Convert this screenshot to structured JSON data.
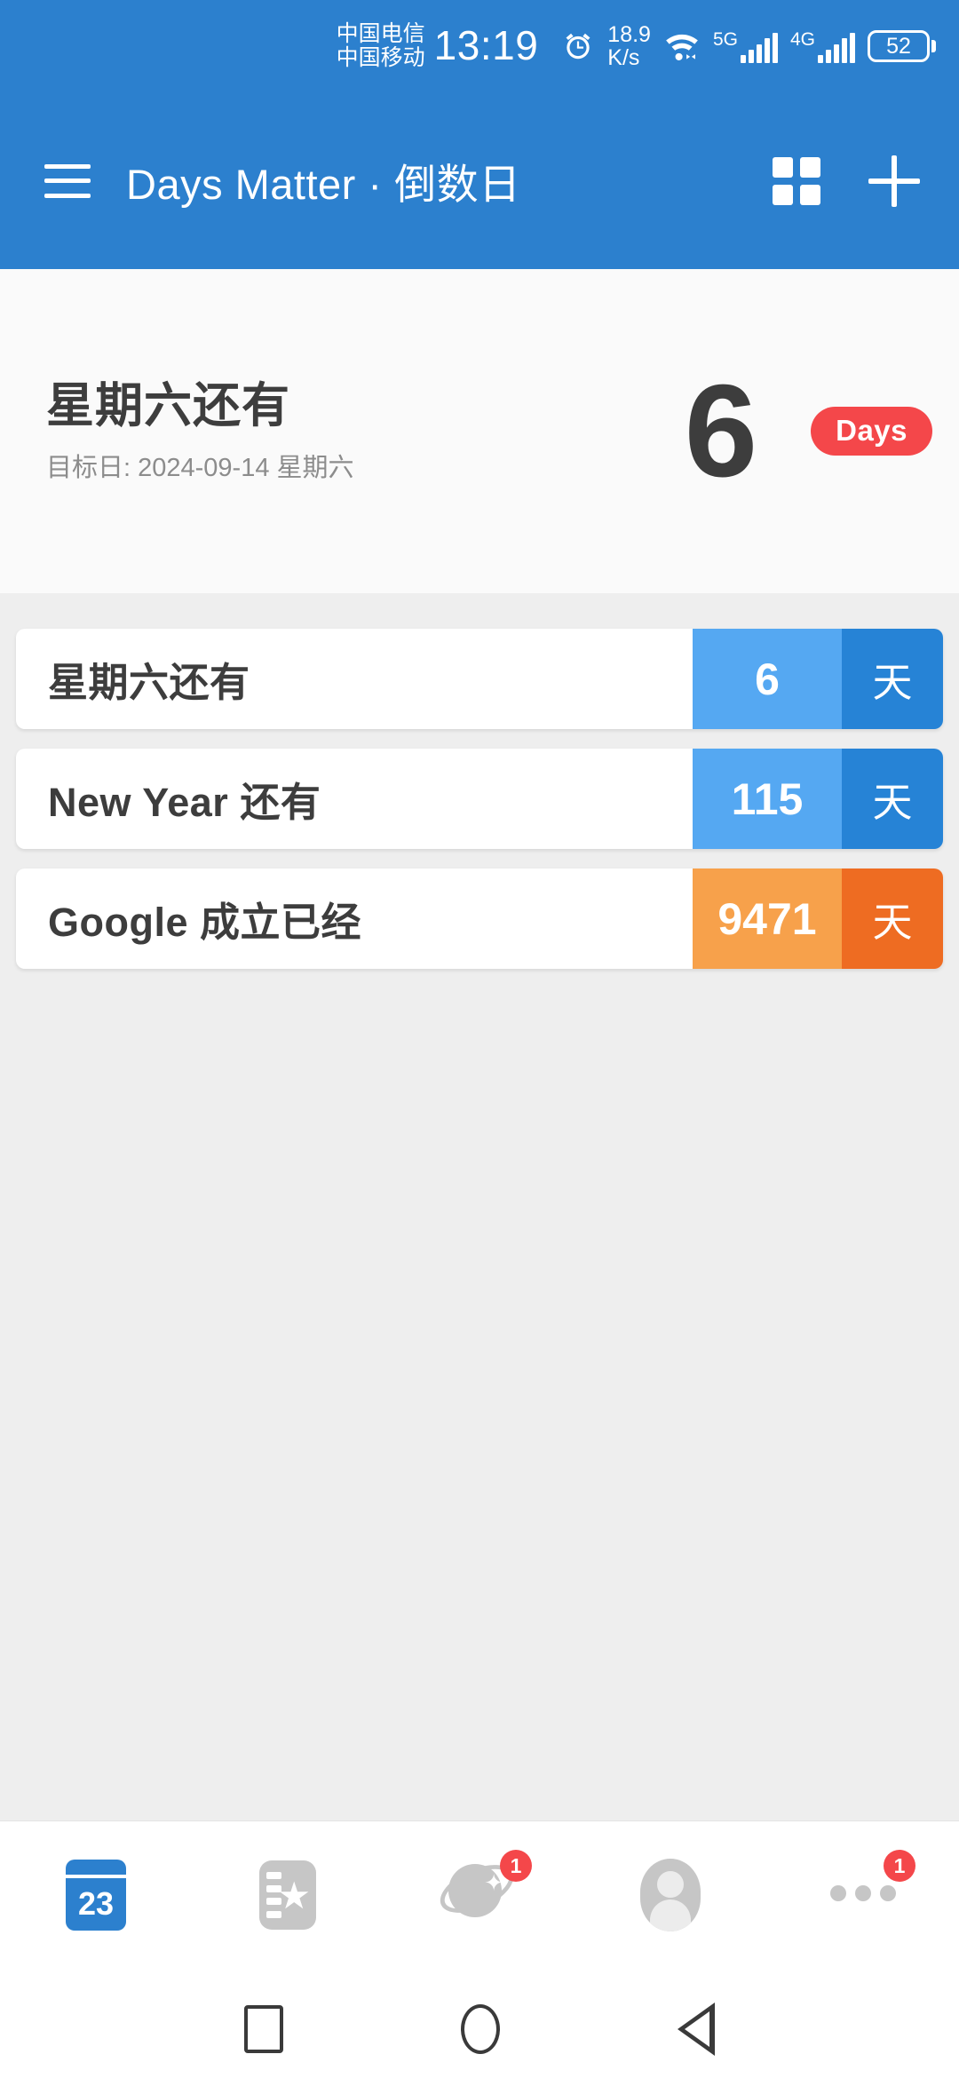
{
  "status_bar": {
    "carrier_primary": "中国电信",
    "carrier_secondary": "中国移动",
    "time": "13:19",
    "alarm_icon": "alarm-icon",
    "network_speed_value": "18.9",
    "network_speed_unit": "K/s",
    "wifi_icon": "wifi-icon",
    "sim1_label": "5G",
    "sim2_label": "4G",
    "battery_level": "52"
  },
  "app_bar": {
    "menu_icon": "hamburger-menu-icon",
    "title": "Days Matter · 倒数日",
    "grid_icon": "grid-view-icon",
    "add_icon": "plus-icon"
  },
  "hero": {
    "title": "星期六还有",
    "subtitle": "目标日: 2024-09-14 星期六",
    "number": "6",
    "badge": "Days"
  },
  "list": {
    "items": [
      {
        "title": "星期六还有",
        "count": "6",
        "unit": "天",
        "count_bg": "#55a8f2",
        "unit_bg": "#2683d6"
      },
      {
        "title": "New Year 还有",
        "count": "115",
        "unit": "天",
        "count_bg": "#55a8f2",
        "unit_bg": "#2683d6"
      },
      {
        "title": "Google 成立已经",
        "count": "9471",
        "unit": "天",
        "count_bg": "#f7a14b",
        "unit_bg": "#ee6c22"
      }
    ]
  },
  "tab_bar": {
    "tabs": [
      {
        "name": "calendar",
        "icon": "calendar-icon",
        "day": "23",
        "badge": ""
      },
      {
        "name": "collection",
        "icon": "ticket-star-icon",
        "badge": ""
      },
      {
        "name": "discover",
        "icon": "planet-icon",
        "badge": "1"
      },
      {
        "name": "profile",
        "icon": "avatar-icon",
        "badge": ""
      },
      {
        "name": "more",
        "icon": "more-dots-icon",
        "badge": "1"
      }
    ]
  },
  "nav_bar": {
    "recents_icon": "square-recents-icon",
    "home_icon": "circle-home-icon",
    "back_icon": "triangle-back-icon"
  },
  "colors": {
    "brand_blue": "#2c80ce",
    "accent_red": "#f4474a",
    "accent_orange": "#ee6c22",
    "page_bg": "#eeeeee"
  }
}
